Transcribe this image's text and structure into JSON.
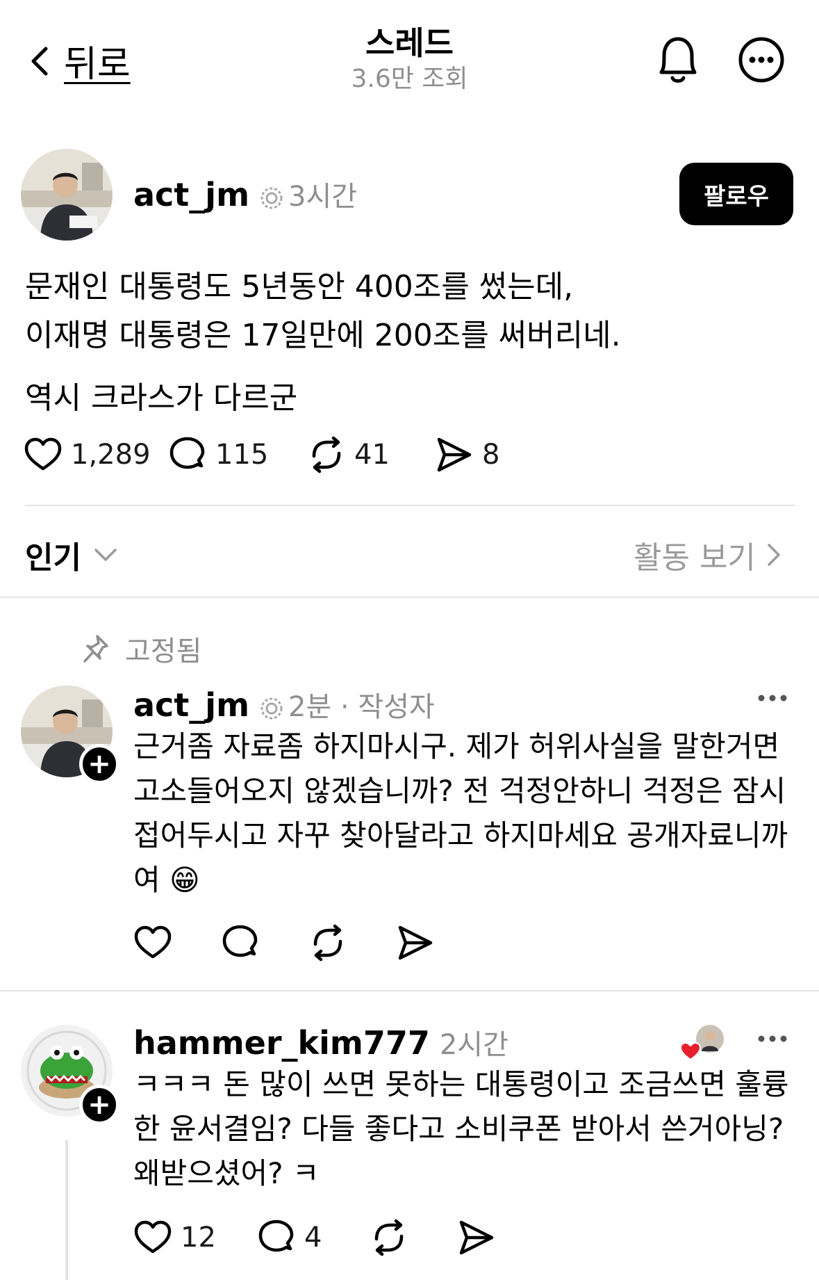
{
  "header": {
    "back_label": "뒤로",
    "title": "스레드",
    "views": "3.6만 조회"
  },
  "post": {
    "username": "act_jm",
    "time": "3시간",
    "follow_label": "팔로우",
    "body": {
      "line1": "문재인 대통령도 5년동안 400조를 썼는데,",
      "line2": "이재명 대통령은 17일만에 200조를 써버리네.",
      "line3": "역시 크라스가 다르군"
    },
    "likes": "1,289",
    "replies": "115",
    "reposts": "41",
    "shares": "8"
  },
  "sort": {
    "label": "인기",
    "activity_label": "활동 보기"
  },
  "pinned_reply": {
    "pinned_label": "고정됨",
    "username": "act_jm",
    "time": "2분",
    "separator": "·",
    "author_tag": "작성자",
    "body": {
      "line1": "근거좀 자료좀 하지마시구. 제가 허위사실을 말한거면",
      "line2": "고소들어오지 않겠습니까? 전 걱정안하니 걱정은 잠시",
      "line3": "접어두시고 자꾸 찾아달라고 하지마세요 공개자료니까",
      "line4": "여 😁"
    }
  },
  "reply2": {
    "username": "hammer_kim777",
    "time": "2시간",
    "body": {
      "line1": "ㅋㅋㅋ 돈 많이 쓰면 못하는 대통령이고 조금쓰면 훌륭",
      "line2": "한 윤서결임?  다들 좋다고 소비쿠폰 받아서 쓴거아닝?",
      "line3": "왜받으셨어? ㅋ"
    },
    "likes": "12",
    "replies": "4"
  },
  "colors": {
    "text": "#000000",
    "muted": "#8e8e8e",
    "divider": "#e3e3e3",
    "follow_bg": "#000000",
    "heart_red": "#e8202e"
  },
  "icons": [
    "chevron-left-icon",
    "bell-icon",
    "more-circle-icon",
    "heart-icon",
    "comment-icon",
    "repost-icon",
    "send-icon",
    "pin-icon",
    "chevron-down-icon",
    "chevron-right-icon",
    "ellipsis-icon",
    "plus-icon",
    "verified-badge-icon"
  ]
}
